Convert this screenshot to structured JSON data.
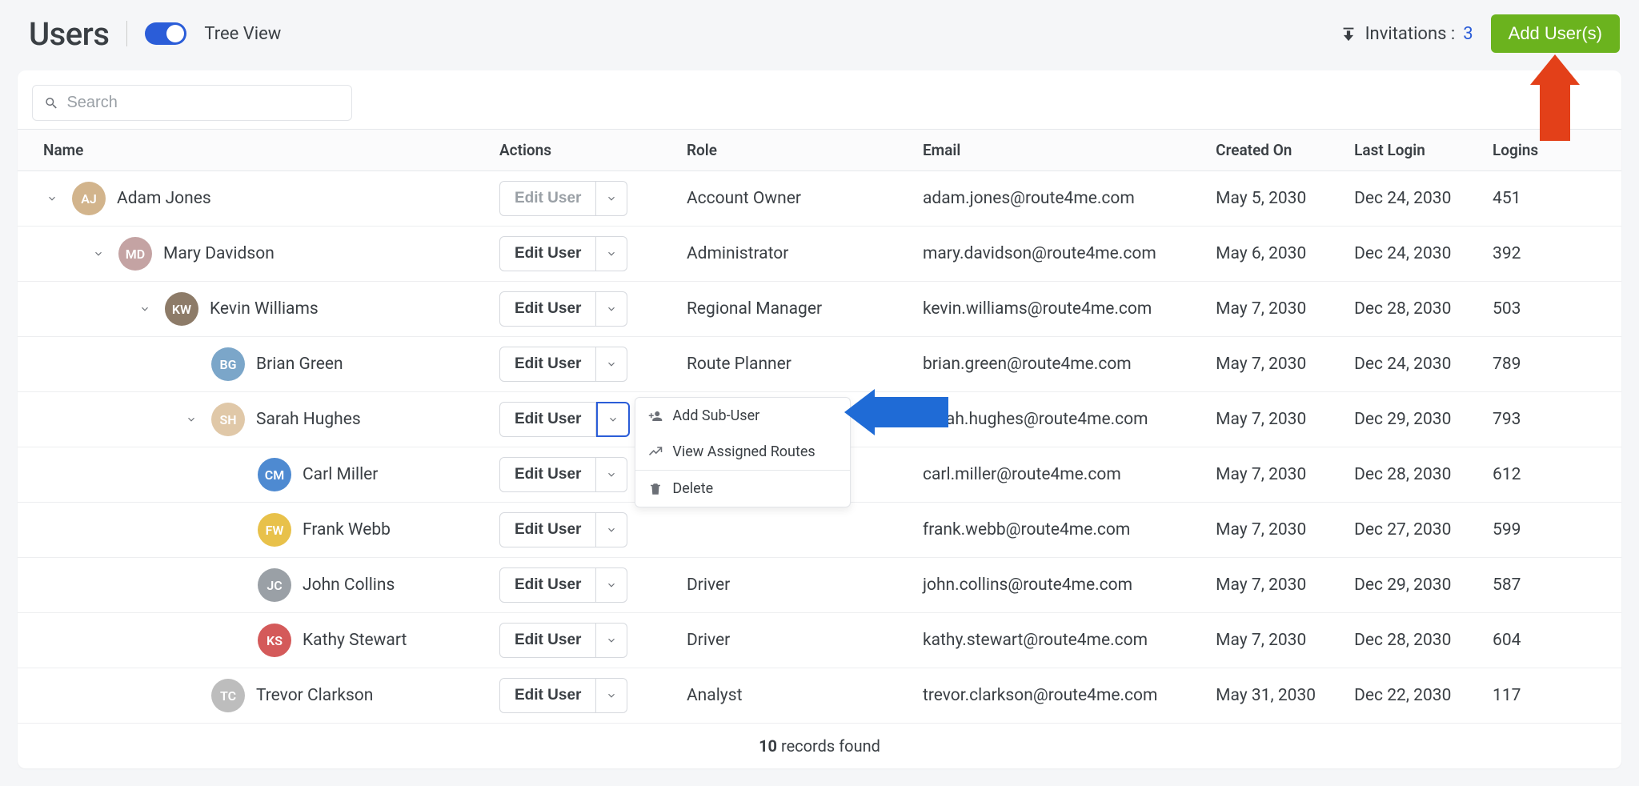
{
  "header": {
    "title": "Users",
    "toggle_label": "Tree View",
    "invitations_label": "Invitations :",
    "invitations_count": "3",
    "add_user_label": "Add User(s)"
  },
  "search": {
    "placeholder": "Search"
  },
  "columns": {
    "name": "Name",
    "actions": "Actions",
    "role": "Role",
    "email": "Email",
    "created": "Created On",
    "last_login": "Last Login",
    "logins": "Logins"
  },
  "rows": [
    {
      "indent": 0,
      "expandable": true,
      "name": "Adam Jones",
      "role": "Account Owner",
      "email": "adam.jones@route4me.com",
      "created": "May 5, 2030",
      "last_login": "Dec 24, 2030",
      "logins": "451",
      "edit_muted": true,
      "avatar_bg": "#d2b48c"
    },
    {
      "indent": 1,
      "expandable": true,
      "name": "Mary Davidson",
      "role": "Administrator",
      "email": "mary.davidson@route4me.com",
      "created": "May 6, 2030",
      "last_login": "Dec 24, 2030",
      "logins": "392",
      "avatar_bg": "#c4a3a3"
    },
    {
      "indent": 2,
      "expandable": true,
      "name": "Kevin Williams",
      "role": "Regional Manager",
      "email": "kevin.williams@route4me.com",
      "created": "May 7, 2030",
      "last_login": "Dec 28, 2030",
      "logins": "503",
      "avatar_bg": "#8d7b68"
    },
    {
      "indent": 3,
      "expandable": false,
      "name": "Brian Green",
      "role": "Route Planner",
      "email": "brian.green@route4me.com",
      "created": "May 7, 2030",
      "last_login": "Dec 24, 2030",
      "logins": "789",
      "avatar_bg": "#7ba6c9"
    },
    {
      "indent": 3,
      "expandable": true,
      "name": "Sarah Hughes",
      "role": "",
      "email": "sarah.hughes@route4me.com",
      "created": "May 7, 2030",
      "last_login": "Dec 29, 2030",
      "logins": "793",
      "drop_active": true,
      "avatar_bg": "#e0c8a8"
    },
    {
      "indent": 4,
      "expandable": false,
      "name": "Carl Miller",
      "role": "",
      "email": "carl.miller@route4me.com",
      "created": "May 7, 2030",
      "last_login": "Dec 28, 2030",
      "logins": "612",
      "avatar_bg": "#4e8ad1"
    },
    {
      "indent": 4,
      "expandable": false,
      "name": "Frank Webb",
      "role": "",
      "email": "frank.webb@route4me.com",
      "created": "May 7, 2030",
      "last_login": "Dec 27, 2030",
      "logins": "599",
      "avatar_bg": "#e8c14a"
    },
    {
      "indent": 4,
      "expandable": false,
      "name": "John Collins",
      "role": "Driver",
      "email": "john.collins@route4me.com",
      "created": "May 7, 2030",
      "last_login": "Dec 29, 2030",
      "logins": "587",
      "avatar_bg": "#9aa0a6"
    },
    {
      "indent": 4,
      "expandable": false,
      "name": "Kathy Stewart",
      "role": "Driver",
      "email": "kathy.stewart@route4me.com",
      "created": "May 7, 2030",
      "last_login": "Dec 28, 2030",
      "logins": "604",
      "avatar_bg": "#d45a5a"
    },
    {
      "indent": 3,
      "expandable": false,
      "name": "Trevor Clarkson",
      "role": "Analyst",
      "email": "trevor.clarkson@route4me.com",
      "created": "May 31, 2030",
      "last_login": "Dec 22, 2030",
      "logins": "117",
      "avatar_bg": "#bdbdbd"
    }
  ],
  "row_label": {
    "edit": "Edit User"
  },
  "dropdown": {
    "add_sub_user": "Add Sub-User",
    "view_routes": "View Assigned Routes",
    "delete": "Delete"
  },
  "footer": {
    "count_bold": "10",
    "count_rest": " records found"
  }
}
